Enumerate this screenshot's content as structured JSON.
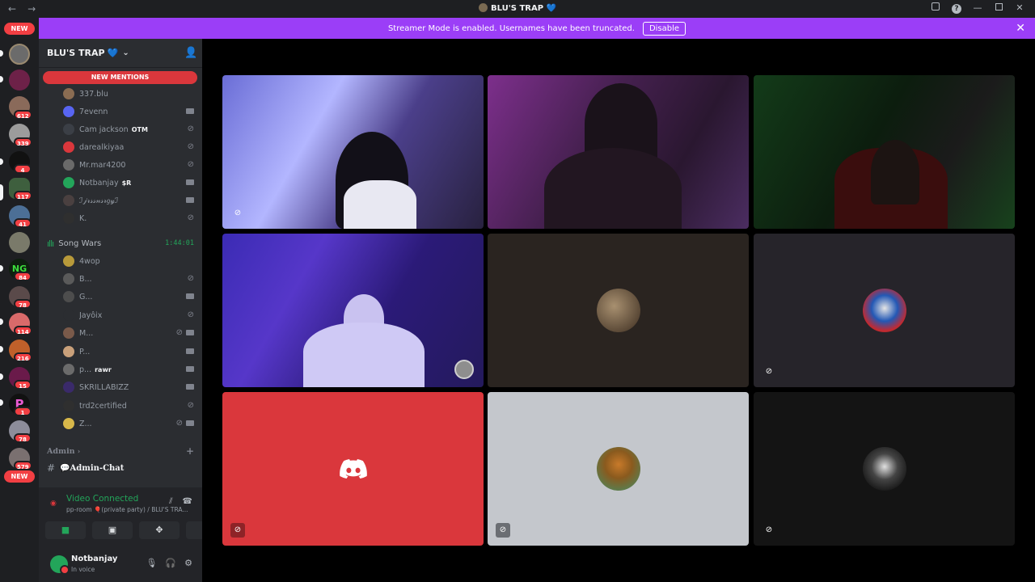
{
  "window": {
    "title": "BLU'S TRAP 💙",
    "back_icon": "←",
    "forward_icon": "→",
    "controls": [
      "inbox",
      "help",
      "minimize",
      "maximize",
      "close"
    ]
  },
  "banner": {
    "text": "Streamer Mode is enabled. Usernames have been truncated.",
    "button": "Disable",
    "close": "✕",
    "color": "#9b3ef7"
  },
  "rail": {
    "top_pill": "NEW",
    "bottom_pill": "NEW",
    "badges": [
      "612",
      "339",
      "4",
      "117",
      "41",
      "84",
      "78",
      "114",
      "216",
      "15",
      "1",
      "78",
      "579"
    ]
  },
  "guild": {
    "name": "BLU'S TRAP",
    "heart": "💙",
    "new_mentions": "NEW MENTIONS"
  },
  "members_top": [
    {
      "name": "337.blu",
      "tag": ""
    },
    {
      "name": "7evenn",
      "tag": ""
    },
    {
      "name": "Cam jackson",
      "tag": "OTM"
    },
    {
      "name": "darealkiyaa",
      "tag": ""
    },
    {
      "name": "Mr.mar4200",
      "tag": ""
    },
    {
      "name": "Notbanjay",
      "tag": "$R"
    },
    {
      "name": "ℐ𝒿𝓇𝓈𝓈𝓃𝓈𝓇𝑔𝓎ℐ",
      "tag": ""
    },
    {
      "name": "K.",
      "tag": ""
    }
  ],
  "voice_channel": {
    "name": "Song Wars",
    "timer": "1:44:01"
  },
  "members_song_wars": [
    {
      "name": "4wop",
      "tag": ""
    },
    {
      "name": "B...",
      "tag": ""
    },
    {
      "name": "G...",
      "tag": ""
    },
    {
      "name": "Jayôix",
      "tag": ""
    },
    {
      "name": "M...",
      "tag": ""
    },
    {
      "name": "P...",
      "tag": ""
    },
    {
      "name": "p...",
      "tag": "rawr"
    },
    {
      "name": "SKRILLABIZZ",
      "tag": ""
    },
    {
      "name": "trd2certified",
      "tag": ""
    },
    {
      "name": "Z...",
      "tag": ""
    }
  ],
  "category": {
    "name": "Admin",
    "channel": "💬Admin-Chat"
  },
  "voice_panel": {
    "status": "Video Connected",
    "sub": "pp-room 🎈(private party) / BLU'S TRA..."
  },
  "user": {
    "name": "Notbanjay",
    "status": "In voice"
  },
  "colors": {
    "green": "#23a55a",
    "red": "#da373c",
    "sidebar": "#2b2d31",
    "rail": "#1e1f22"
  }
}
